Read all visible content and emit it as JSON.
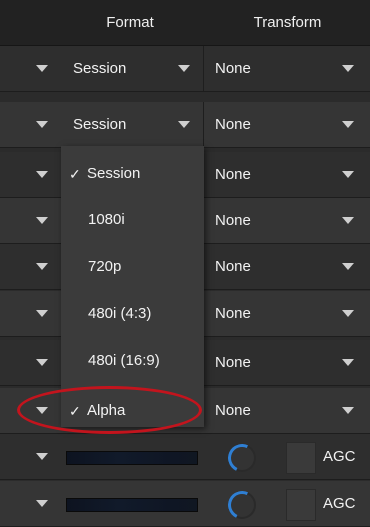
{
  "header": {
    "col_format": "Format",
    "col_transform": "Transform"
  },
  "rows": [
    {
      "format": "Session",
      "transform": "None"
    },
    {
      "format": "Session",
      "transform": "None"
    },
    {
      "format": "",
      "transform": "None"
    },
    {
      "format": "",
      "transform": "None"
    },
    {
      "format": "",
      "transform": "None"
    },
    {
      "format": "",
      "transform": "None"
    },
    {
      "format": "",
      "transform": "None"
    },
    {
      "format": "",
      "transform": "None"
    }
  ],
  "dropdown": {
    "checkmark": "✓",
    "options": [
      "Session",
      "1080i",
      "720p",
      "480i (4:3)",
      "480i (16:9)",
      "Alpha"
    ],
    "checked_top": "Session",
    "selected": "Alpha"
  },
  "audio_rows": [
    {
      "agc_label": "AGC"
    },
    {
      "agc_label": "AGC"
    }
  ],
  "colors": {
    "highlight": "#c3141d",
    "knob_accent": "#2f7fd3"
  }
}
